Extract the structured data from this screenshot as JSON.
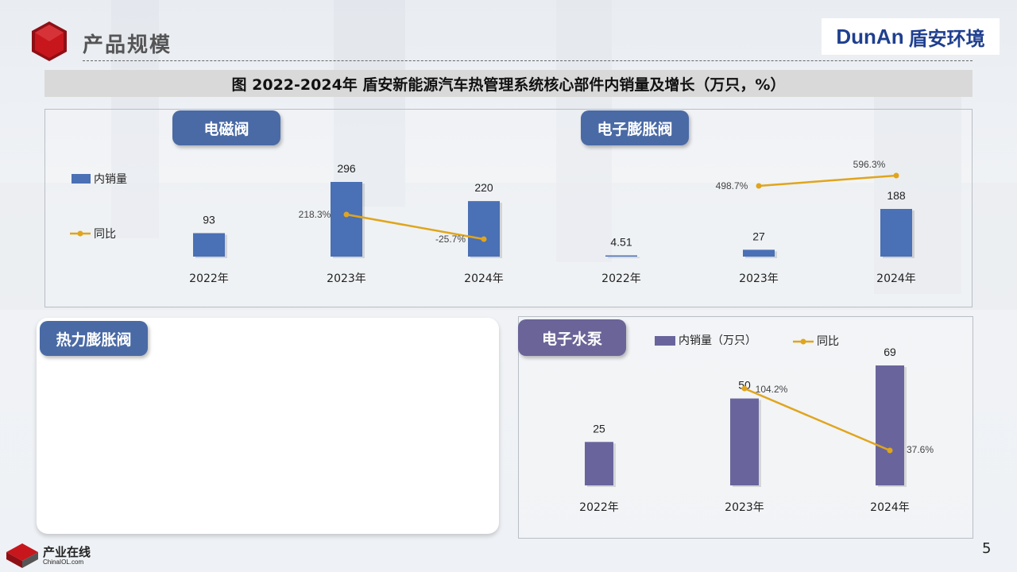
{
  "header": {
    "section_title": "产品规模",
    "brand_en": "DunAn",
    "brand_cn": "盾安环境",
    "figure_title": "图 2022-2024年 盾安新能源汽车热管理系统核心部件内销量及增长（万只，%）"
  },
  "tags": {
    "dianci": "电磁阀",
    "dianzi_pengzhang": "电子膨胀阀",
    "reli_pengzhang": "热力膨胀阀",
    "dianzi_shuibeng": "电子水泵"
  },
  "footer": {
    "logo_cn": "产业在线",
    "logo_en": "ChinaIOL.com",
    "page_number": "5"
  },
  "colors": {
    "bar_blue": "#4a70b5",
    "bar_purple": "#69659c",
    "line_gold": "#e0a51c",
    "tag_blue": "#4a6aa5",
    "tag_purple": "#6a6498",
    "logo_red": "#c8161d"
  },
  "chart_data": [
    {
      "id": "solenoid",
      "type": "bar",
      "panel_title": "电磁阀",
      "categories": [
        "2022年",
        "2023年",
        "2024年"
      ],
      "series": [
        {
          "name": "内销量",
          "kind": "bar",
          "values": [
            93,
            296,
            220
          ],
          "labels": [
            "93",
            "296",
            "220"
          ]
        },
        {
          "name": "同比",
          "kind": "line",
          "values": [
            null,
            218.3,
            -25.7
          ],
          "labels": [
            "",
            "218.3%",
            "-25.7%"
          ]
        }
      ],
      "legend": [
        "内销量",
        "同比"
      ]
    },
    {
      "id": "eev",
      "type": "bar",
      "panel_title": "电子膨胀阀",
      "categories": [
        "2022年",
        "2023年",
        "2024年"
      ],
      "series": [
        {
          "name": "内销量",
          "kind": "bar",
          "values": [
            4.51,
            27,
            188
          ],
          "labels": [
            "4.51",
            "27",
            "188"
          ]
        },
        {
          "name": "同比",
          "kind": "line",
          "values": [
            null,
            498.7,
            596.3
          ],
          "labels": [
            "",
            "498.7%",
            "596.3%"
          ]
        }
      ]
    },
    {
      "id": "pump",
      "type": "bar",
      "panel_title": "电子水泵",
      "categories": [
        "2022年",
        "2023年",
        "2024年"
      ],
      "series": [
        {
          "name": "内销量（万只）",
          "kind": "bar",
          "values": [
            25,
            50,
            69
          ],
          "labels": [
            "25",
            "50",
            "69"
          ]
        },
        {
          "name": "同比",
          "kind": "line",
          "values": [
            null,
            104.2,
            37.6
          ],
          "labels": [
            "",
            "104.2%",
            "37.6%"
          ]
        }
      ],
      "legend": [
        "内销量（万只）",
        "同比"
      ]
    }
  ]
}
